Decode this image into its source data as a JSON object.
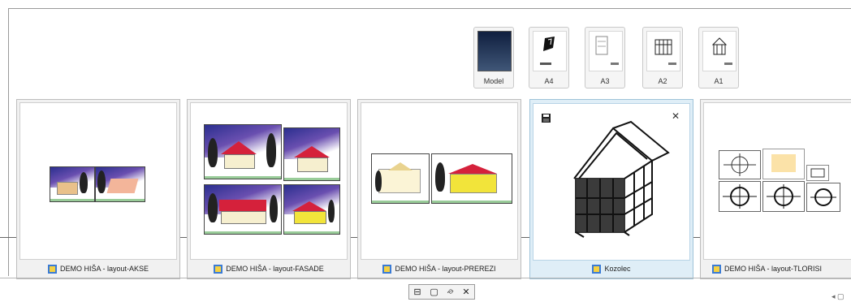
{
  "templates": [
    {
      "label": "Model",
      "icon": "model-icon"
    },
    {
      "label": "A4",
      "icon": "a4-sheet-icon"
    },
    {
      "label": "A3",
      "icon": "a3-sheet-icon"
    },
    {
      "label": "A2",
      "icon": "a2-sheet-icon"
    },
    {
      "label": "A1",
      "icon": "a1-sheet-icon"
    }
  ],
  "layouts": [
    {
      "caption": "DEMO HIŠA - layout-AKSE",
      "icon": "layout-doc-icon"
    },
    {
      "caption": "DEMO HIŠA - layout-FASADE",
      "icon": "layout-doc-icon"
    },
    {
      "caption": "DEMO HIŠA - layout-PREREZI",
      "icon": "layout-doc-icon"
    },
    {
      "caption": "Kozolec",
      "icon": "layout-doc-icon",
      "selected": true
    },
    {
      "caption": "DEMO HIŠA - layout-TLORISI",
      "icon": "layout-doc-icon"
    }
  ],
  "toolbar": {
    "icons": [
      "pin-icon",
      "new-sheet-icon",
      "open-icon",
      "close-icon"
    ],
    "glyphs": [
      "⊟",
      "▢",
      "⌮",
      "✕"
    ]
  },
  "card_actions": {
    "save_icon": "save-icon",
    "close_glyph": "✕"
  },
  "corner": {
    "text": "◂ ▢"
  },
  "colors": {
    "selected_bg": "#dfeef7",
    "accent": "#2b2f8f"
  }
}
